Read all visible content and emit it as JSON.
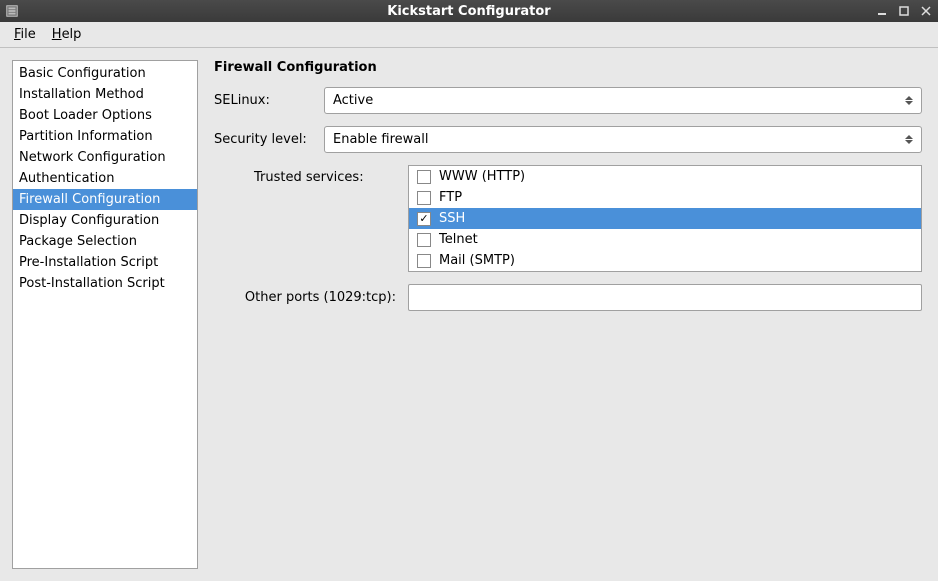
{
  "window": {
    "title": "Kickstart Configurator"
  },
  "menubar": {
    "file": {
      "label": "File",
      "mnemonic": "F"
    },
    "help": {
      "label": "Help",
      "mnemonic": "H"
    }
  },
  "sidebar": {
    "items": [
      {
        "label": "Basic Configuration",
        "selected": false
      },
      {
        "label": "Installation Method",
        "selected": false
      },
      {
        "label": "Boot Loader Options",
        "selected": false
      },
      {
        "label": "Partition Information",
        "selected": false
      },
      {
        "label": "Network Configuration",
        "selected": false
      },
      {
        "label": "Authentication",
        "selected": false
      },
      {
        "label": "Firewall Configuration",
        "selected": true
      },
      {
        "label": "Display Configuration",
        "selected": false
      },
      {
        "label": "Package Selection",
        "selected": false
      },
      {
        "label": "Pre-Installation Script",
        "selected": false
      },
      {
        "label": "Post-Installation Script",
        "selected": false
      }
    ]
  },
  "main": {
    "title": "Firewall Configuration",
    "selinux": {
      "label": "SELinux:",
      "value": "Active"
    },
    "security_level": {
      "label": "Security level:",
      "value": "Enable firewall"
    },
    "trusted_services": {
      "label": "Trusted services:",
      "items": [
        {
          "label": "WWW (HTTP)",
          "checked": false,
          "selected": false
        },
        {
          "label": "FTP",
          "checked": false,
          "selected": false
        },
        {
          "label": "SSH",
          "checked": true,
          "selected": true
        },
        {
          "label": "Telnet",
          "checked": false,
          "selected": false
        },
        {
          "label": "Mail (SMTP)",
          "checked": false,
          "selected": false
        }
      ]
    },
    "other_ports": {
      "label": "Other ports (1029:tcp):",
      "value": ""
    }
  }
}
